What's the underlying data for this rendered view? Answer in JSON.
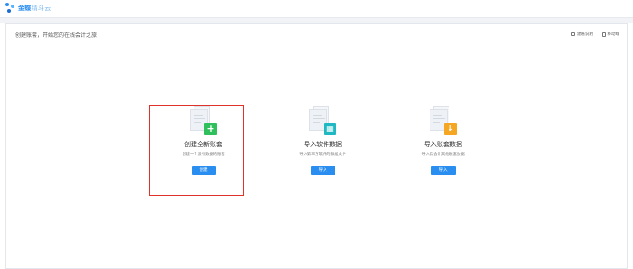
{
  "app": {
    "logo_main": "金蝶",
    "logo_sub": "精斗云"
  },
  "page": {
    "title": "创建账套，开始您的在线会计之旅"
  },
  "top_actions": [
    {
      "label": "建账说明",
      "icon": "document-icon"
    },
    {
      "label": "移动端",
      "icon": "mobile-icon"
    }
  ],
  "cards": [
    {
      "title": "创建全新账套",
      "desc": "创建一个没有数据的账套",
      "button": "创建",
      "badge_color": "#2fbf5b",
      "badge_icon": "plus-icon",
      "badge_glyph": "+"
    },
    {
      "title": "导入软件数据",
      "desc": "导入第三方软件的数据文件",
      "button": "导入",
      "badge_color": "#1fb8c3",
      "badge_icon": "grid-icon",
      "badge_glyph": "▦"
    },
    {
      "title": "导入账套数据",
      "desc": "导入云会计其他账套数据",
      "button": "导入",
      "badge_color": "#f5a623",
      "badge_icon": "download-arrow-icon",
      "badge_glyph": "↓"
    }
  ]
}
